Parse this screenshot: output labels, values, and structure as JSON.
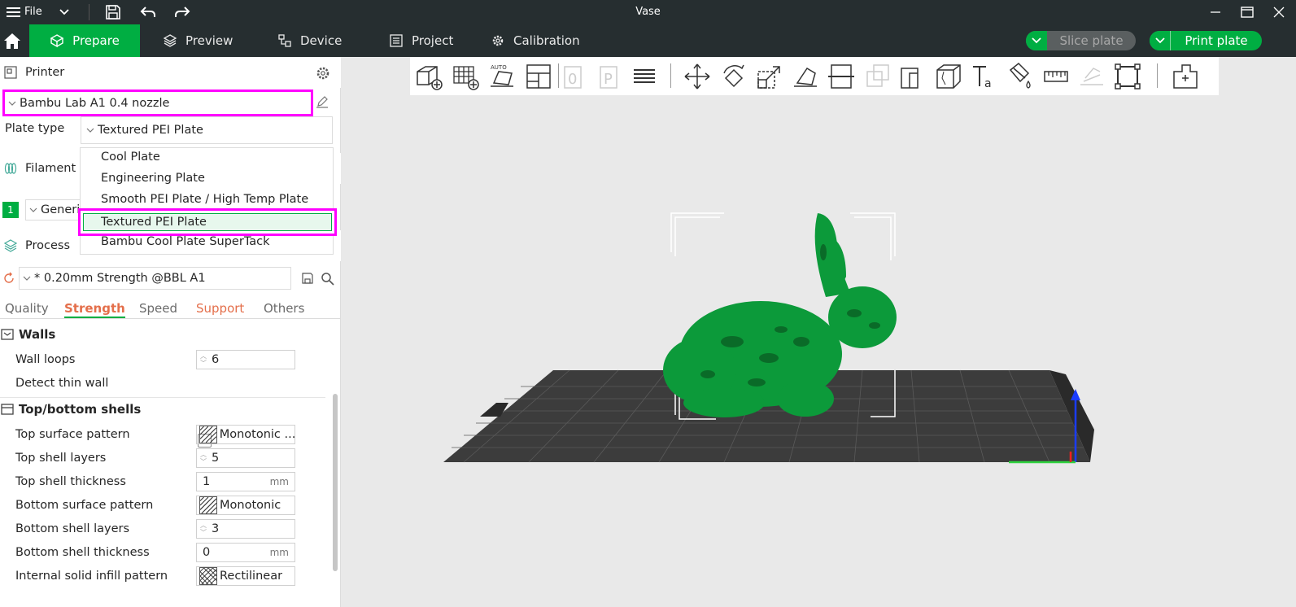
{
  "titlebar": {
    "file_label": "File",
    "title": "Vase"
  },
  "nav": {
    "tabs": [
      {
        "label": "Prepare"
      },
      {
        "label": "Preview"
      },
      {
        "label": "Device"
      },
      {
        "label": "Project"
      },
      {
        "label": "Calibration"
      }
    ],
    "slice_label": "Slice plate",
    "print_label": "Print plate"
  },
  "printer": {
    "section_label": "Printer",
    "selected": "Bambu Lab A1 0.4 nozzle",
    "plate_type_label": "Plate type",
    "plate_type_value": "Textured PEI Plate"
  },
  "plate_options": [
    "Cool Plate",
    "Engineering Plate",
    "Smooth PEI Plate / High Temp Plate",
    "Textured PEI Plate",
    "Bambu Cool Plate SuperTack"
  ],
  "filament": {
    "section_label": "Filament",
    "slot": "1",
    "name": "Generic"
  },
  "process": {
    "section_label": "Process",
    "profile": "* 0.20mm Strength @BBL A1",
    "tabs": [
      "Quality",
      "Strength",
      "Speed",
      "Support",
      "Others"
    ]
  },
  "settings": {
    "walls_label": "Walls",
    "wall_loops_label": "Wall loops",
    "wall_loops": "6",
    "detect_thin_label": "Detect thin wall",
    "shells_label": "Top/bottom shells",
    "top_pattern_label": "Top surface pattern",
    "top_pattern": "Monotonic ...",
    "top_layers_label": "Top shell layers",
    "top_layers": "5",
    "top_thick_label": "Top shell thickness",
    "top_thick": "1",
    "bottom_pattern_label": "Bottom surface pattern",
    "bottom_pattern": "Monotonic",
    "bottom_layers_label": "Bottom shell layers",
    "bottom_layers": "3",
    "bottom_thick_label": "Bottom shell thickness",
    "bottom_thick": "0",
    "infill_pattern_label": "Internal solid infill pattern",
    "infill_pattern": "Rectilinear",
    "unit": "mm"
  },
  "colors": {
    "accent": "#00ae42",
    "highlight": "#ff00ff",
    "bar": "#262e30"
  }
}
